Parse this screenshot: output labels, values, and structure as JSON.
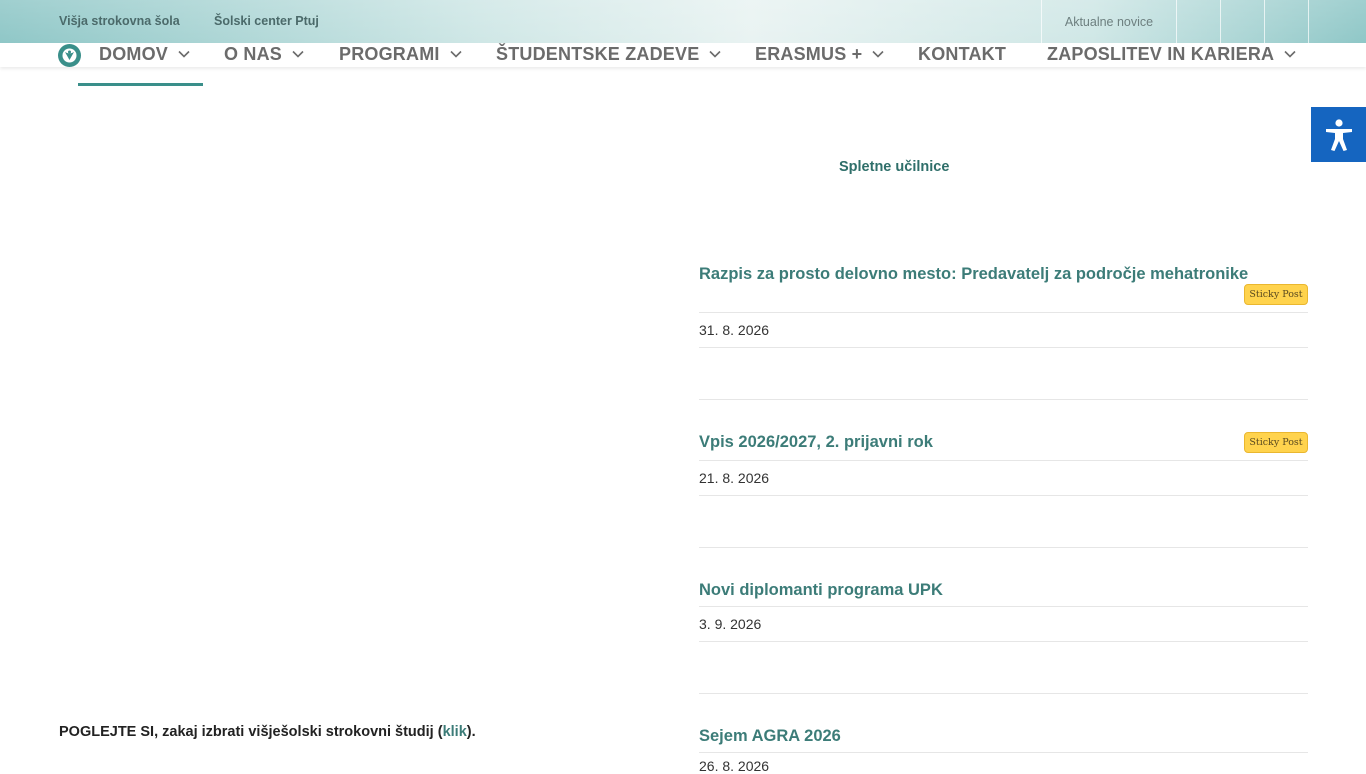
{
  "topbar": {
    "link_school": "Višja strokovna šola",
    "link_center": "Šolski center Ptuj",
    "news": "Aktualne novice"
  },
  "nav": {
    "items": [
      {
        "label": "DOMOV",
        "has_dropdown": true
      },
      {
        "label": "O NAS",
        "has_dropdown": true
      },
      {
        "label": "PROGRAMI",
        "has_dropdown": true
      },
      {
        "label": "ŠTUDENTSKE ZADEVE",
        "has_dropdown": true
      },
      {
        "label": "ERASMUS +",
        "has_dropdown": true
      },
      {
        "label": "KONTAKT",
        "has_dropdown": false
      },
      {
        "label": "ZAPOSLITEV IN KARIERA",
        "has_dropdown": true
      }
    ],
    "active": "DOMOV"
  },
  "sidebar_link": "Spletne učilnice",
  "posts": [
    {
      "title": "Razpis za prosto delovno mesto: Predavatelj za področje mehatronike",
      "sticky": "Sticky Post",
      "date": "31. 8. 2026"
    },
    {
      "title": "Vpis 2026/2027, 2. prijavni rok",
      "sticky": "Sticky Post",
      "date": "21. 8. 2026"
    },
    {
      "title": "Novi diplomanti programa UPK",
      "date": "3. 9. 2026"
    },
    {
      "title": "Sejem AGRA 2026",
      "date": "26. 8. 2026"
    }
  ],
  "promo": {
    "text_before": "POGLEJTE SI, zakaj izbrati višješolski strokovni študij (",
    "link": "klik",
    "text_after": ")."
  },
  "colors": {
    "accent": "#3c7c78",
    "sticky_badge": "#ffd34d",
    "accessibility": "#1565c0"
  },
  "icons": {
    "logo": "school-logo-icon",
    "dropdown": "chevron-down-icon",
    "accessibility": "accessibility-icon"
  }
}
